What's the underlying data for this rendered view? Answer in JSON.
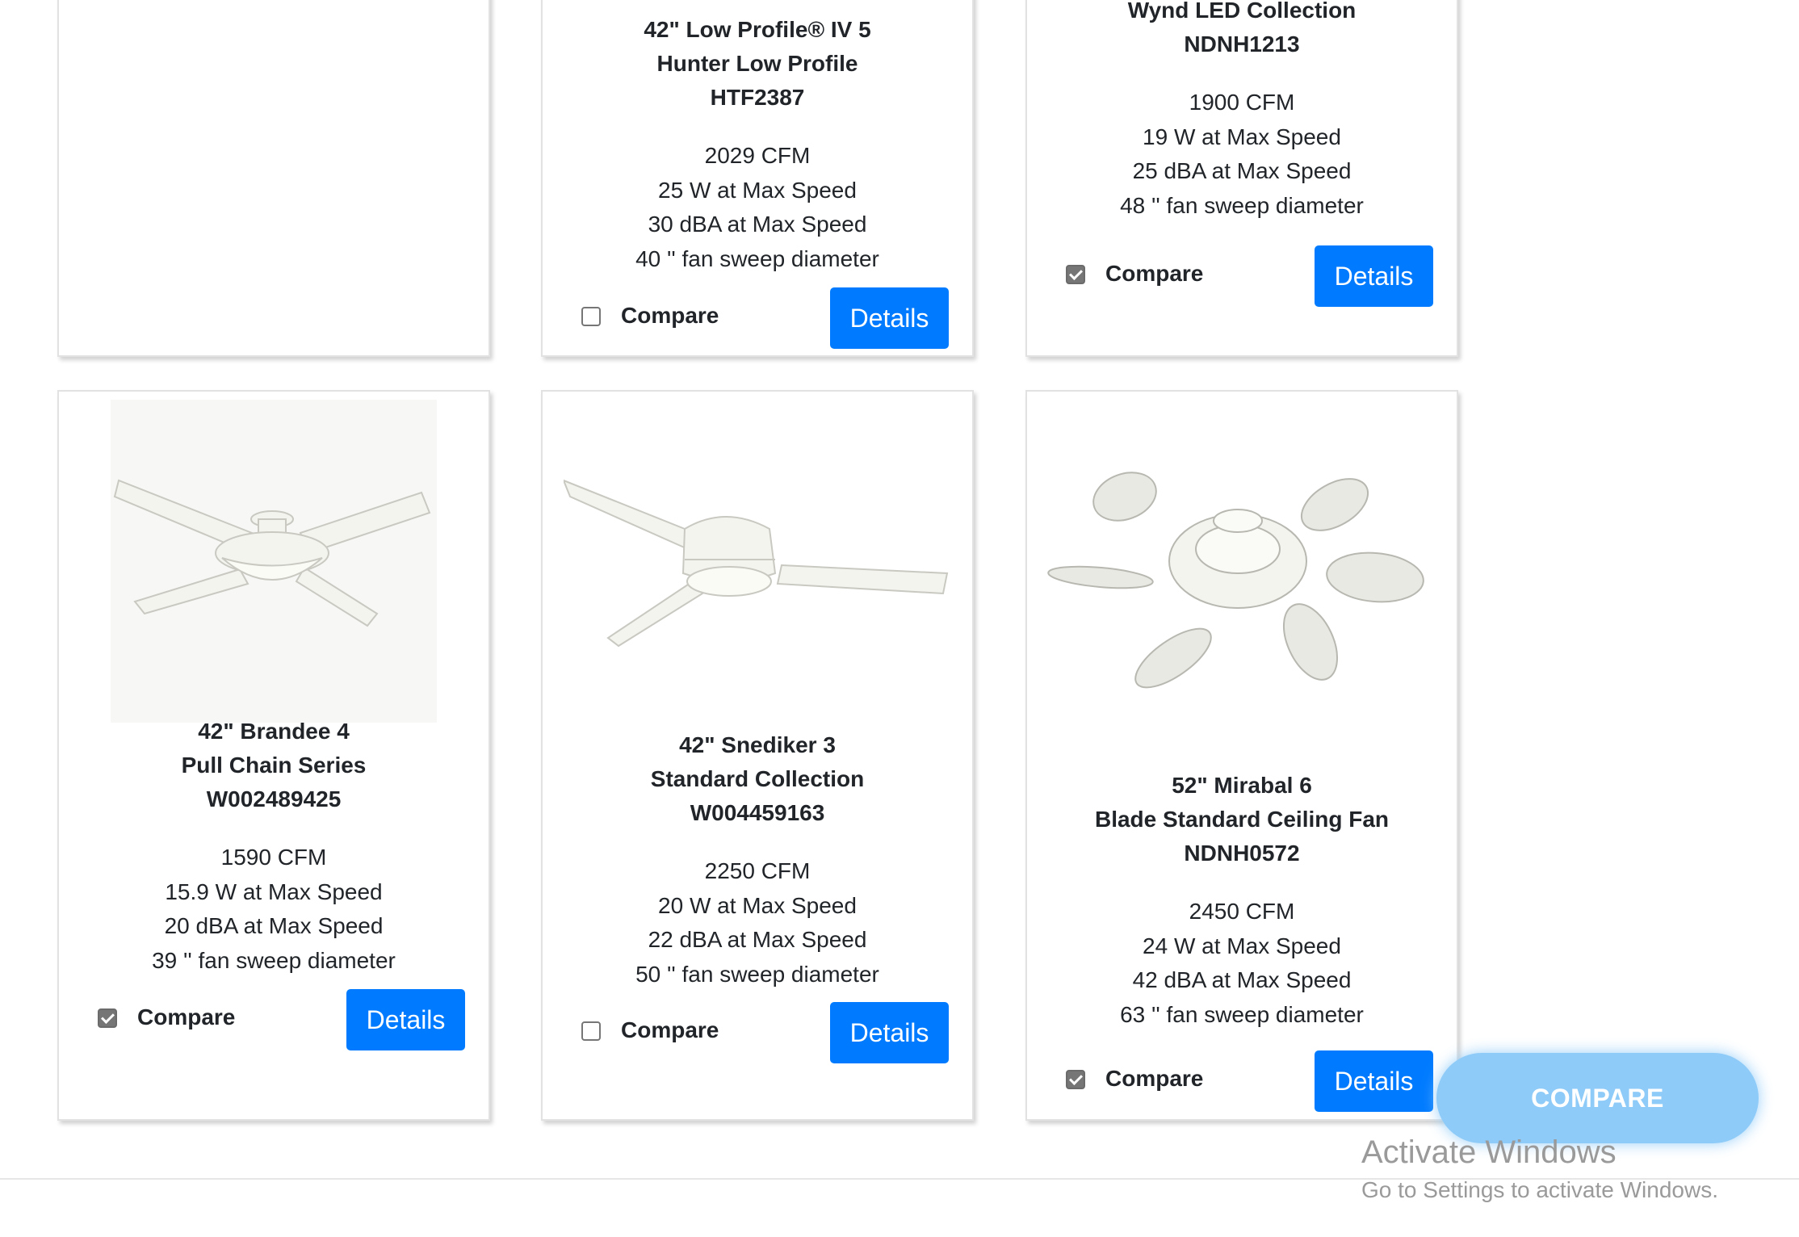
{
  "products": [
    {
      "name_lines": [],
      "specs": [],
      "compare_checked": null,
      "compare_label": "",
      "details_label": ""
    },
    {
      "name_lines": [
        "42\" Low Profile® IV 5",
        "Hunter Low Profile",
        "HTF2387"
      ],
      "specs": [
        "2029 CFM",
        "25 W at Max Speed",
        "30 dBA at Max Speed",
        "40 '' fan sweep diameter"
      ],
      "compare_checked": false,
      "compare_label": "Compare",
      "details_label": "Details"
    },
    {
      "name_lines": [
        "Wynd LED Collection",
        "NDNH1213"
      ],
      "specs": [
        "1900 CFM",
        "19 W at Max Speed",
        "25 dBA at Max Speed",
        "48 '' fan sweep diameter"
      ],
      "compare_checked": true,
      "compare_label": "Compare",
      "details_label": "Details"
    },
    {
      "name_lines": [
        "42\" Brandee 4",
        "Pull Chain Series",
        "W002489425"
      ],
      "specs": [
        "1590 CFM",
        "15.9 W at Max Speed",
        "20 dBA at Max Speed",
        "39 '' fan sweep diameter"
      ],
      "compare_checked": true,
      "compare_label": "Compare",
      "details_label": "Details",
      "image": "four-blade-ceiling-fan-with-light"
    },
    {
      "name_lines": [
        "42\" Snediker 3",
        "Standard Collection",
        "W004459163"
      ],
      "specs": [
        "2250 CFM",
        "20 W at Max Speed",
        "22 dBA at Max Speed",
        "50 '' fan sweep diameter"
      ],
      "compare_checked": false,
      "compare_label": "Compare",
      "details_label": "Details",
      "image": "three-blade-ceiling-fan-with-light"
    },
    {
      "name_lines": [
        "52\" Mirabal 6",
        "Blade Standard Ceiling Fan",
        "NDNH0572"
      ],
      "specs": [
        "2450 CFM",
        "24 W at Max Speed",
        "42 dBA at Max Speed",
        "63 '' fan sweep diameter"
      ],
      "compare_checked": true,
      "compare_label": "Compare",
      "details_label": "Details",
      "image": "six-blade-ceiling-fan"
    }
  ],
  "compare_button_label": "COMPARE",
  "watermark": {
    "title": "Activate Windows",
    "subtitle": "Go to Settings to activate Windows."
  },
  "colors": {
    "primary": "#007bff",
    "compare_fab": "#8ecbf8",
    "checkbox_checked": "#767676"
  }
}
